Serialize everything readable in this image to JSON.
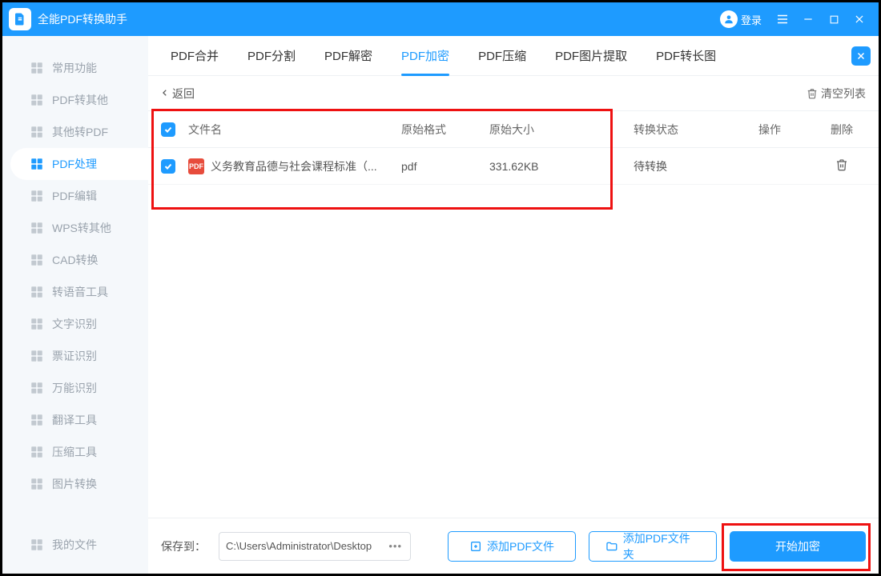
{
  "window": {
    "title": "全能PDF转换助手",
    "login": "登录"
  },
  "sidebar": {
    "items": [
      {
        "label": "常用功能"
      },
      {
        "label": "PDF转其他"
      },
      {
        "label": "其他转PDF"
      },
      {
        "label": "PDF处理"
      },
      {
        "label": "PDF编辑"
      },
      {
        "label": "WPS转其他"
      },
      {
        "label": "CAD转换"
      },
      {
        "label": "转语音工具"
      },
      {
        "label": "文字识别"
      },
      {
        "label": "票证识别"
      },
      {
        "label": "万能识别"
      },
      {
        "label": "翻译工具"
      },
      {
        "label": "压缩工具"
      },
      {
        "label": "图片转换"
      }
    ],
    "bottom": {
      "label": "我的文件"
    },
    "active_index": 3
  },
  "tabs": {
    "items": [
      {
        "label": "PDF合并"
      },
      {
        "label": "PDF分割"
      },
      {
        "label": "PDF解密"
      },
      {
        "label": "PDF加密"
      },
      {
        "label": "PDF压缩"
      },
      {
        "label": "PDF图片提取"
      },
      {
        "label": "PDF转长图"
      }
    ],
    "active_index": 3
  },
  "toolbar": {
    "back": "返回",
    "clear": "清空列表"
  },
  "table": {
    "headers": {
      "name": "文件名",
      "format": "原始格式",
      "size": "原始大小",
      "status": "转换状态",
      "op": "操作",
      "del": "删除"
    },
    "rows": [
      {
        "name": "义务教育品德与社会课程标准（...",
        "format": "pdf",
        "size": "331.62KB",
        "status": "待转换"
      }
    ]
  },
  "bottom": {
    "save_label": "保存到：",
    "save_path": "C:\\Users\\Administrator\\Desktop",
    "add_file": "添加PDF文件",
    "add_folder": "添加PDF文件夹",
    "start": "开始加密"
  }
}
